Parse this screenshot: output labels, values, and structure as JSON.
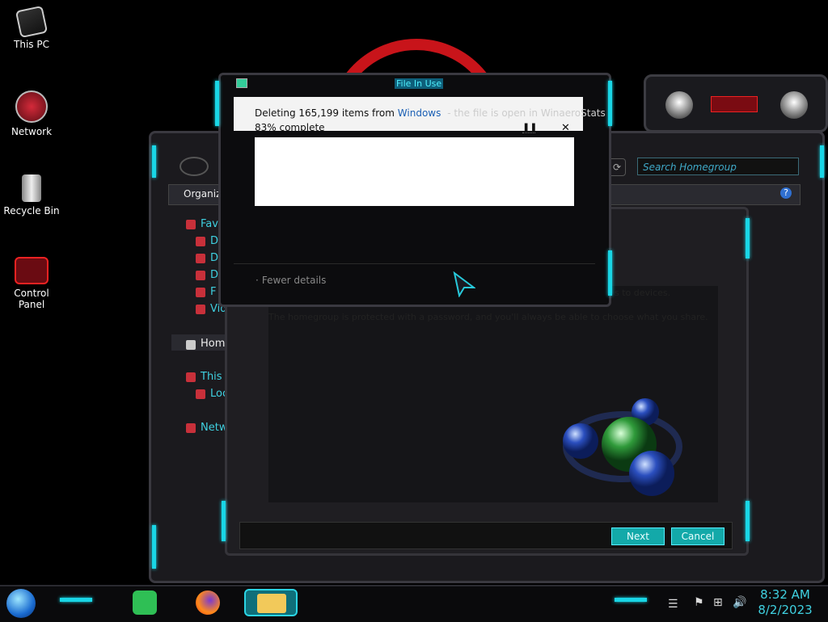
{
  "desktop": {
    "icons": [
      {
        "label": "This PC"
      },
      {
        "label": "Network"
      },
      {
        "label": "Recycle Bin"
      },
      {
        "label": "Control Panel"
      }
    ]
  },
  "explorer": {
    "toolbar_label": "Organize",
    "search_placeholder": "Search Homegroup",
    "nav": [
      {
        "label": "Favorites"
      },
      {
        "label": "D"
      },
      {
        "label": "D"
      },
      {
        "label": "D"
      },
      {
        "label": "F"
      },
      {
        "label": "Vid"
      },
      {
        "label": "Hom"
      },
      {
        "label": "This"
      },
      {
        "label": "Loc"
      },
      {
        "label": "Netw"
      }
    ],
    "wizard": {
      "text_partial": "s to devices.",
      "text_line": "The homegroup is protected with a password, and you'll always be able to choose what you share.",
      "next_label": "Next",
      "cancel_label": "Cancel"
    }
  },
  "progress_dialog": {
    "title": "File In Use",
    "line_prefix": "Deleting 165,199 items from ",
    "line_link": "Windows",
    "line_suffix": "- the file is open in WinaeroStats",
    "percent_text": "83% complete",
    "pause_icon": "pause-icon",
    "close_icon": "close-icon",
    "fewer_details": "Fewer details"
  },
  "taskbar": {
    "time": "8:32 AM",
    "date": "8/2/2023"
  },
  "colors": {
    "accent_cyan": "#19d6e6",
    "ring_red": "#c8141a",
    "link_blue": "#1a5fb4"
  }
}
